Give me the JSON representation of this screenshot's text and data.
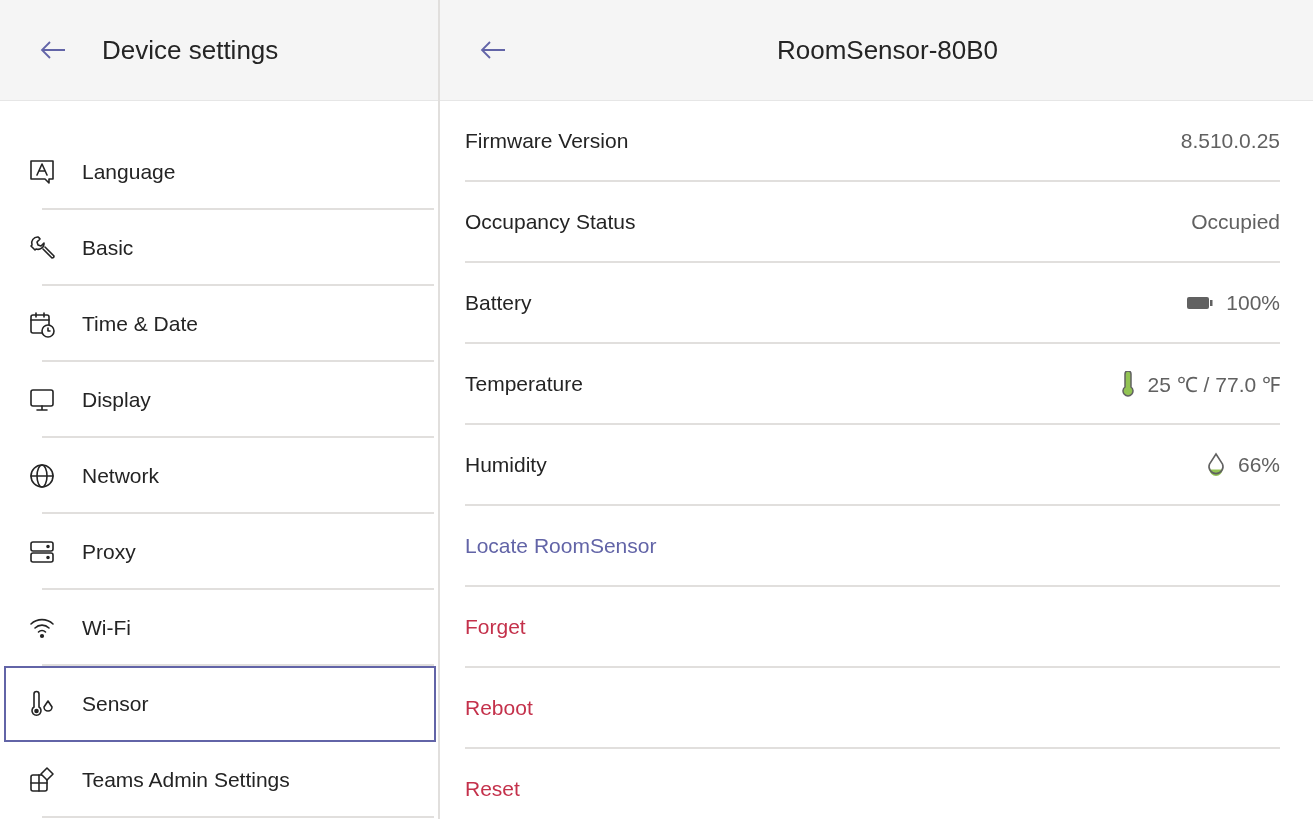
{
  "sidebar": {
    "title": "Device settings",
    "items": [
      {
        "label": "Language",
        "kind": "language",
        "selected": false
      },
      {
        "label": "Basic",
        "kind": "wrench",
        "selected": false
      },
      {
        "label": "Time & Date",
        "kind": "calendar",
        "selected": false
      },
      {
        "label": "Display",
        "kind": "monitor",
        "selected": false
      },
      {
        "label": "Network",
        "kind": "globe",
        "selected": false
      },
      {
        "label": "Proxy",
        "kind": "server",
        "selected": false
      },
      {
        "label": "Wi-Fi",
        "kind": "wifi",
        "selected": false
      },
      {
        "label": "Sensor",
        "kind": "sensor",
        "selected": true
      },
      {
        "label": "Teams Admin Settings",
        "kind": "apps",
        "selected": false
      }
    ]
  },
  "detail": {
    "title": "RoomSensor-80B0",
    "rows": [
      {
        "label": "Firmware Version",
        "value": "8.510.0.25"
      },
      {
        "label": "Occupancy Status",
        "value": "Occupied"
      },
      {
        "label": "Battery",
        "value": "100%",
        "kind": "battery"
      },
      {
        "label": "Temperature",
        "value": "25 ℃ / 77.0 ℉",
        "kind": "thermometer"
      },
      {
        "label": "Humidity",
        "value": "66%",
        "kind": "drop"
      }
    ],
    "actions": [
      {
        "label": "Locate RoomSensor",
        "kind": "link"
      },
      {
        "label": "Forget",
        "kind": "danger"
      },
      {
        "label": "Reboot",
        "kind": "danger"
      },
      {
        "label": "Reset",
        "kind": "danger"
      }
    ]
  }
}
